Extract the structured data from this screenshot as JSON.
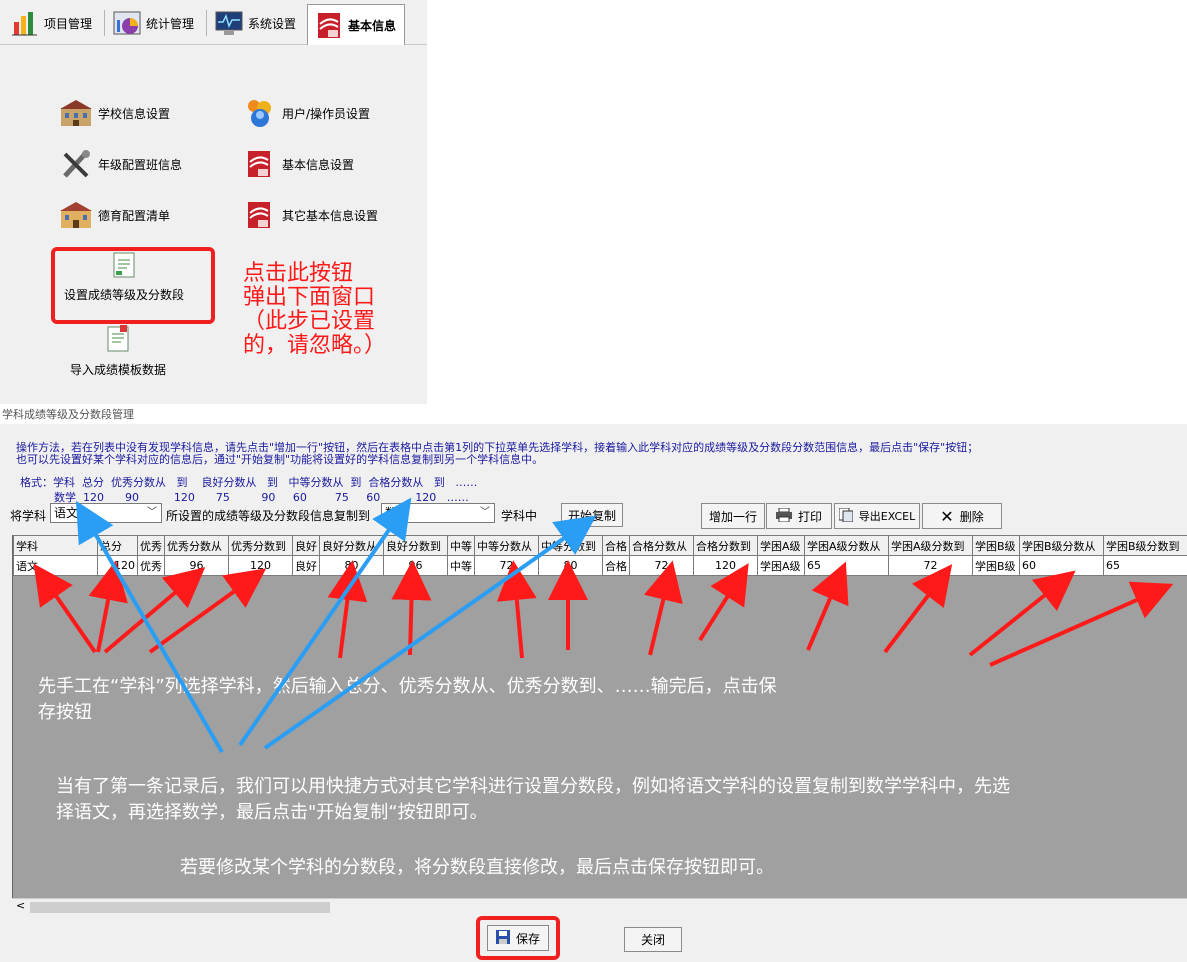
{
  "tabs": [
    {
      "label": "项目管理",
      "icon": "chart-icon"
    },
    {
      "label": "统计管理",
      "icon": "stats-icon"
    },
    {
      "label": "系统设置",
      "icon": "monitor-icon"
    },
    {
      "label": "基本信息",
      "icon": "book-icon",
      "active": true
    }
  ],
  "menu": {
    "school_info": "学校信息设置",
    "users": "用户/操作员设置",
    "grade_class": "年级配置班信息",
    "basic_info": "基本信息设置",
    "moral": "德育配置清单",
    "other_basic": "其它基本信息设置",
    "grade_levels": "设置成绩等级及分数段",
    "import_template": "导入成绩模板数据"
  },
  "red_note": [
    "点击此按钮",
    "弹出下面窗口",
    "（此步已设置",
    "的，请忽略。）"
  ],
  "window": {
    "title": "学科成绩等级及分数段管理",
    "instructions": [
      "操作方法，若在列表中没有发现学科信息，请先点击\"增加一行\"按钮，然后在表格中点击第1列的下拉菜单先选择学科，接着输入此学科对应的成绩等级及分数段分数范围信息，最后点击\"保存\"按钮；",
      "也可以先设置好某个学科对应的信息后，通过\"开始复制\"功能将设置好的学科信息复制到另一个学科信息中。"
    ],
    "format_line1": "格式：学科  总分  优秀分数从   到    良好分数从   到   中等分数从  到  合格分数从   到   ……",
    "format_line2": "数学  120      90          120      75         90     60        75     60          120   ……",
    "copy_label_prefix": "将学科",
    "copy_from": "语文",
    "copy_label_mid": "所设置的成绩等级及分数段信息复制到",
    "copy_to": "数学",
    "copy_label_suffix": "学科中",
    "copy_button": "开始复制",
    "add_row": "增加一行",
    "print": "打印",
    "export": "导出EXCEL",
    "delete": "删除",
    "save": "保存",
    "close": "关闭"
  },
  "table": {
    "headers": [
      "学科",
      "总分",
      "优秀",
      "优秀分数从",
      "优秀分数到",
      "良好",
      "良好分数从",
      "良好分数到",
      "中等",
      "中等分数从",
      "中等分数到",
      "合格",
      "合格分数从",
      "合格分数到",
      "学困A级",
      "学困A级分数从",
      "学困A级分数到",
      "学困B级",
      "学困B级分数从",
      "学困B级分数到"
    ],
    "rows": [
      [
        "语文",
        "120",
        "优秀",
        "96",
        "120",
        "良好",
        "80",
        "96",
        "中等",
        "72",
        "80",
        "合格",
        "72",
        "120",
        "学困A级",
        "65",
        "72",
        "学困B级",
        "60",
        "65"
      ]
    ]
  },
  "notes": {
    "note1_line1": "先手工在“学科”列选择学科，然后输入总分、优秀分数从、优秀分数到、……输完后，点击保",
    "note1_line2": "存按钮",
    "note2_line1": "当有了第一条记录后，我们可以用快捷方式对其它学科进行设置分数段，例如将语文学科的设置复制到数学学科中，先选",
    "note2_line2": "择语文，再选择数学，最后点击\"开始复制“按钮即可。",
    "note3": "若要修改某个学科的分数段，将分数段直接修改，最后点击保存按钮即可。"
  },
  "colors": {
    "annotation_red": "#ff1a1a",
    "arrow_blue": "#2a9df4",
    "grid_bg": "#a0a0a0",
    "instruction_blue": "#1a1aa0"
  }
}
